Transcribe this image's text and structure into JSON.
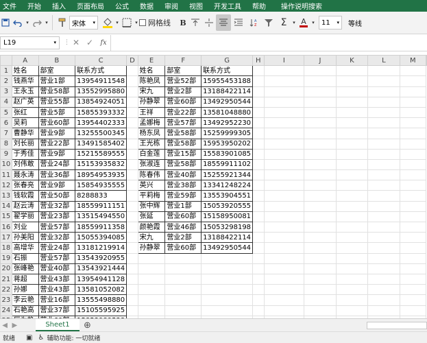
{
  "menu": {
    "items": [
      "文件",
      "开始",
      "插入",
      "页面布局",
      "公式",
      "数据",
      "审阅",
      "视图",
      "开发工具",
      "帮助",
      "操作说明搜索"
    ]
  },
  "ribbon": {
    "font_name": "宋体",
    "font_size": "11",
    "wrap_label": "网格线",
    "number_format": "等线"
  },
  "formula_bar": {
    "cell_ref": "L19",
    "fx": "fx",
    "formula": ""
  },
  "columns": [
    "A",
    "B",
    "C",
    "D",
    "E",
    "F",
    "G",
    "H",
    "I",
    "J",
    "K",
    "L",
    "M"
  ],
  "headers": {
    "name": "姓名",
    "dept": "部室",
    "phone": "联系方式"
  },
  "left_rows": [
    [
      "钱燕华",
      "营业1部",
      "13954911548"
    ],
    [
      "王永玉",
      "营业58部",
      "13552995880"
    ],
    [
      "赵广英",
      "营业55部",
      "13854924051"
    ],
    [
      "张红",
      "营业5部",
      "15855393332"
    ],
    [
      "吴莉",
      "营业60部",
      "13954402333"
    ],
    [
      "曹静华",
      "营业9部",
      "13255500345"
    ],
    [
      "刘长丽",
      "营业22部",
      "13491585402"
    ],
    [
      "于秀佳",
      "营业9部",
      "15215589555"
    ],
    [
      "刘伟敢",
      "营业24部",
      "15153935832"
    ],
    [
      "聂永涛",
      "营业36部",
      "18954953935"
    ],
    [
      "张春亮",
      "营业9部",
      "15854935555"
    ],
    [
      "钱软霞",
      "营业50部",
      "8288833"
    ],
    [
      "赵云涛",
      "营业32部",
      "18559911151"
    ],
    [
      "翟学丽",
      "营业23部",
      "13515494550"
    ],
    [
      "刘业",
      "营业57部",
      "18559911358"
    ],
    [
      "孙美阳",
      "营业32部",
      "15055394085"
    ],
    [
      "高增华",
      "营业24部",
      "13181219914"
    ],
    [
      "石振",
      "营业57部",
      "13543920955"
    ],
    [
      "张峰艳",
      "营业40部",
      "13543921444"
    ],
    [
      "蒋超",
      "营业43部",
      "13954941128"
    ],
    [
      "孙娜",
      "营业43部",
      "13581052082"
    ],
    [
      "李云艳",
      "营业16部",
      "13555498880"
    ],
    [
      "石艳高",
      "营业37部",
      "15105595925"
    ],
    [
      "厉为艳",
      "营业60部",
      "15853989538"
    ],
    [
      "陈艳凤",
      "营业52部",
      "15955453188"
    ],
    [
      "宋九",
      "营业2部",
      "13188422114"
    ]
  ],
  "right_rows": [
    [
      "陈艳凤",
      "营业52部",
      "15955453188"
    ],
    [
      "宋九",
      "营业2部",
      "13188422114"
    ],
    [
      "孙静翠",
      "营业60部",
      "13492950544"
    ],
    [
      "王祥",
      "营业22部",
      "13581048880"
    ],
    [
      "孟娜梅",
      "营业57部",
      "13492952230"
    ],
    [
      "杨东凤",
      "营业58部",
      "15259999305"
    ],
    [
      "王光栋",
      "营业58部",
      "15953950202"
    ],
    [
      "白金莲",
      "营业15部",
      "15583901085"
    ],
    [
      "张淑连",
      "营业58部",
      "18559911102"
    ],
    [
      "陈春伟",
      "营业40部",
      "15255921344"
    ],
    [
      "英兴",
      "营业38部",
      "13341248224"
    ],
    [
      "平莉梅",
      "营业59部",
      "13553904551"
    ],
    [
      "张中辉",
      "营业1部",
      "15053920555"
    ],
    [
      "张延",
      "营业60部",
      "15158950081"
    ],
    [
      "颜艳霞",
      "营业46部",
      "15053298198"
    ],
    [
      "宋九",
      "营业2部",
      "13188422114"
    ],
    [
      "孙静翠",
      "营业60部",
      "13492950544"
    ]
  ],
  "sheet_tabs": [
    "Sheet1"
  ],
  "status": {
    "mode": "就绪",
    "accessibility": "辅助功能: 一切就绪"
  },
  "colors": {
    "menu_bg": "#217346",
    "accent": "#217346",
    "font_color_bar": "#c00000",
    "fill_color_bar": "#ffd700"
  }
}
